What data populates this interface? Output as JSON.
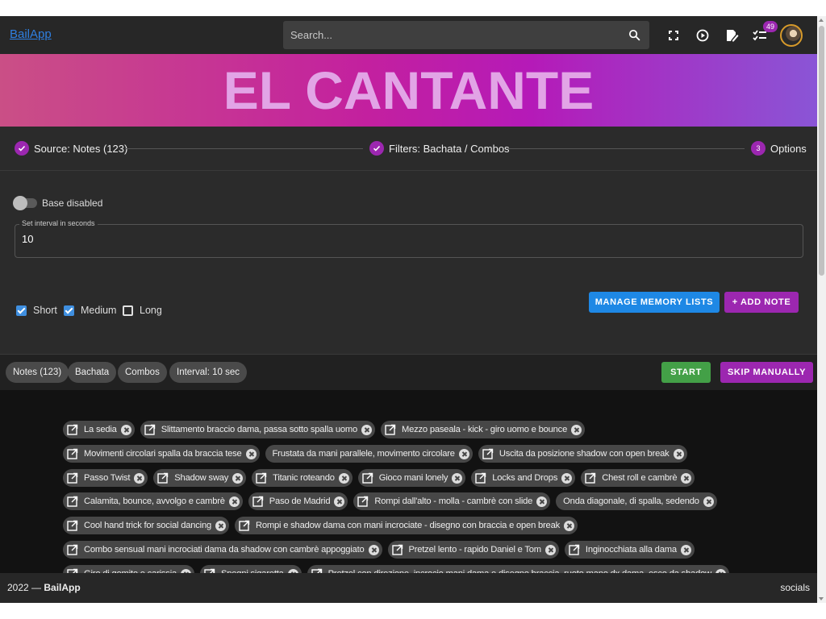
{
  "header": {
    "brand": "BailApp",
    "search_placeholder": "Search...",
    "icons": [
      "fullscreen-icon",
      "play-history-icon",
      "edit-note-icon",
      "checklist-icon"
    ],
    "badge_count": "49"
  },
  "banner": {
    "title": "EL CANTANTE"
  },
  "stepper": {
    "steps": [
      {
        "label": "Source: Notes (123)",
        "state": "done"
      },
      {
        "label": "Filters: Bachata / Combos",
        "state": "done"
      },
      {
        "label": "Options",
        "number": "3",
        "state": "active"
      }
    ]
  },
  "options": {
    "switch_label": "Base disabled",
    "interval_label": "Set interval in seconds",
    "interval_value": "10",
    "checkboxes": [
      {
        "label": "Short",
        "checked": true
      },
      {
        "label": "Medium",
        "checked": true
      },
      {
        "label": "Long",
        "checked": false
      }
    ],
    "manage_button": "MANAGE MEMORY LISTS",
    "add_note_button": "+ ADD NOTE"
  },
  "filterbar": {
    "chips": [
      "Notes (123)",
      "Bachata",
      "Combos",
      "Interval: 10 sec"
    ],
    "start_button": "START",
    "skip_button": "SKIP MANUALLY"
  },
  "notes": {
    "rows": [
      [
        {
          "t": "La sedia"
        },
        {
          "t": "Slittamento braccio dama, passa sotto spalla uomo"
        },
        {
          "t": "Mezzo paseala - kick - giro uomo e bounce"
        }
      ],
      [
        {
          "t": "Movimenti circolari spalla da braccia tese"
        },
        {
          "t": "Frustata da mani parallele, movimento circolare",
          "plain": true
        },
        {
          "t": "Uscita da posizione shadow con open break"
        }
      ],
      [
        {
          "t": "Passo Twist"
        },
        {
          "t": "Shadow sway"
        },
        {
          "t": "Titanic roteando"
        },
        {
          "t": "Gioco mani lonely"
        },
        {
          "t": "Locks and Drops"
        },
        {
          "t": "Chest roll e cambrè"
        }
      ],
      [
        {
          "t": "Calamita, bounce, avvolgo e cambrè"
        },
        {
          "t": "Paso de Madrid"
        },
        {
          "t": "Rompi dall'alto - molla - cambrè con slide"
        },
        {
          "t": "Onda diagonale, di spalla, sedendo",
          "plain": true
        }
      ],
      [
        {
          "t": "Cool hand trick for social dancing"
        },
        {
          "t": "Rompi e shadow dama con mani incrociate - disegno con braccia e open break"
        }
      ],
      [
        {
          "t": "Combo sensual mani incrociati dama da shadow con cambrè appoggiato"
        },
        {
          "t": "Pretzel lento - rapido Daniel e Tom"
        },
        {
          "t": "Inginocchiata alla dama"
        }
      ],
      [
        {
          "t": "Giro di gomito e carissia"
        },
        {
          "t": "Spegni sigaretta"
        },
        {
          "t": "Pretzel con direzione, incrocio mani dama e disegno braccia, ruoto mano dx dama, esco da shadow"
        }
      ]
    ]
  },
  "footer": {
    "year": "2022 — ",
    "brand": "BailApp",
    "socials": "socials"
  },
  "colors": {
    "accent": "#9c27b0",
    "blue": "#1e88e5",
    "green": "#43a047"
  }
}
